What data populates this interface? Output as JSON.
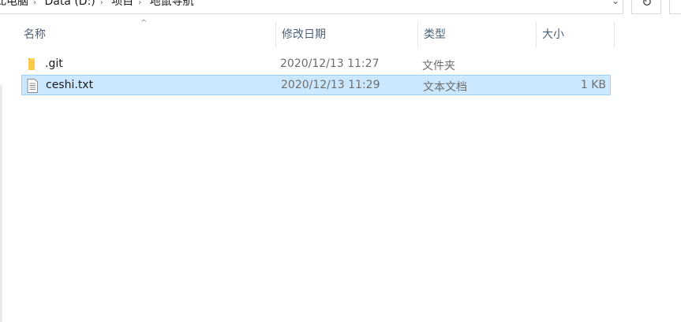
{
  "address_bar": {
    "crumbs": [
      "此电脑",
      "Data (D:)",
      "项目",
      "地鼠导航"
    ]
  },
  "columns": {
    "name": "名称",
    "date": "修改日期",
    "type": "类型",
    "size": "大小"
  },
  "files": [
    {
      "name": ".git",
      "date": "2020/12/13 11:27",
      "type": "文件夹",
      "size": "",
      "icon": "folder-icon",
      "selected": false
    },
    {
      "name": "ceshi.txt",
      "date": "2020/12/13 11:29",
      "type": "文本文档",
      "size": "1 KB",
      "icon": "text-file-icon",
      "selected": true
    }
  ],
  "colors": {
    "selection_bg": "#cce8ff",
    "selection_border": "#99d1ff",
    "header_text": "#4c607a",
    "folder": "#ffd35c"
  }
}
